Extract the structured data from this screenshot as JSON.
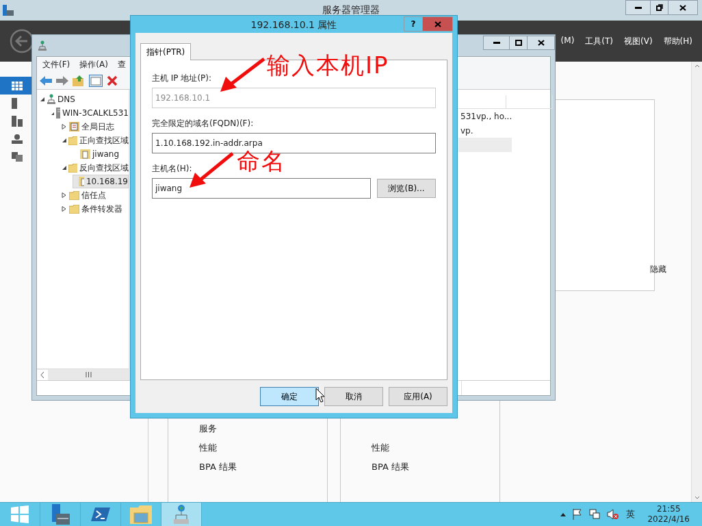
{
  "server_manager": {
    "title": "服务器管理器",
    "menu": [
      {
        "label": "(M)"
      },
      {
        "label": "工具(T)"
      },
      {
        "label": "视图(V)"
      },
      {
        "label": "帮助(H)"
      }
    ],
    "sidebar": [
      {
        "kind": "dashboard",
        "selected": true
      },
      {
        "kind": "server",
        "selected": false
      },
      {
        "kind": "servers",
        "selected": false
      },
      {
        "kind": "dns",
        "selected": false
      },
      {
        "kind": "files",
        "selected": false
      }
    ],
    "tiles": [
      {
        "items": [
          "服务",
          "性能",
          "BPA 结果"
        ]
      },
      {
        "items": [
          "性能",
          "BPA 结果"
        ]
      }
    ],
    "panel": {
      "hide_label": "隐藏"
    }
  },
  "dns_window": {
    "menu": [
      {
        "label": "文件(F)"
      },
      {
        "label": "操作(A)"
      },
      {
        "label": "查"
      }
    ],
    "tree": [
      {
        "label": "DNS",
        "kind": "dns",
        "expanded": true,
        "selected": false,
        "children": [
          {
            "label": "WIN-3CALKL531",
            "kind": "server",
            "expanded": true,
            "selected": false,
            "children": [
              {
                "label": "全局日志",
                "kind": "log",
                "expanded": false,
                "selected": false
              },
              {
                "label": "正向查找区域",
                "kind": "folder",
                "expanded": true,
                "selected": false,
                "children": [
                  {
                    "label": "jiwang",
                    "kind": "zone",
                    "selected": false
                  }
                ]
              },
              {
                "label": "反向查找区域",
                "kind": "folder",
                "expanded": true,
                "selected": false,
                "children": [
                  {
                    "label": "10.168.19",
                    "kind": "zone",
                    "selected": true
                  }
                ]
              },
              {
                "label": "信任点",
                "kind": "folder",
                "expanded": false,
                "selected": false
              },
              {
                "label": "条件转发器",
                "kind": "folder",
                "expanded": false,
                "selected": false
              }
            ]
          }
        ]
      }
    ],
    "list_rows": [
      {
        "text": "531vp., ho...",
        "selected": false
      },
      {
        "text": "vp.",
        "selected": false
      },
      {
        "selected": true
      }
    ]
  },
  "dialog": {
    "title": "192.168.10.1 属性",
    "help": "?",
    "tabs": [
      {
        "label": "指针(PTR)",
        "selected": true
      }
    ],
    "fields": [
      {
        "label": "主机 IP 地址(P):",
        "value": "192.168.10.1",
        "disabled": true
      },
      {
        "label": "完全限定的域名(FQDN)(F):",
        "value": "1.10.168.192.in-addr.arpa",
        "disabled": false
      },
      {
        "label": "主机名(H):",
        "value": "jiwang",
        "disabled": false,
        "button": "浏览(B)..."
      }
    ],
    "buttons": [
      {
        "label": "确定",
        "default": true
      },
      {
        "label": "取消",
        "default": false
      },
      {
        "label": "应用(A)",
        "default": false
      }
    ]
  },
  "annotations": [
    {
      "text": "输入本机IP"
    },
    {
      "text": "命名"
    }
  ],
  "taskbar": {
    "apps": [
      {
        "kind": "server-manager",
        "selected": false
      },
      {
        "kind": "powershell",
        "selected": false
      },
      {
        "kind": "explorer",
        "selected": false
      },
      {
        "kind": "dns",
        "selected": true
      }
    ],
    "ime": "英",
    "time": "21:55",
    "date": "2022/4/16"
  }
}
